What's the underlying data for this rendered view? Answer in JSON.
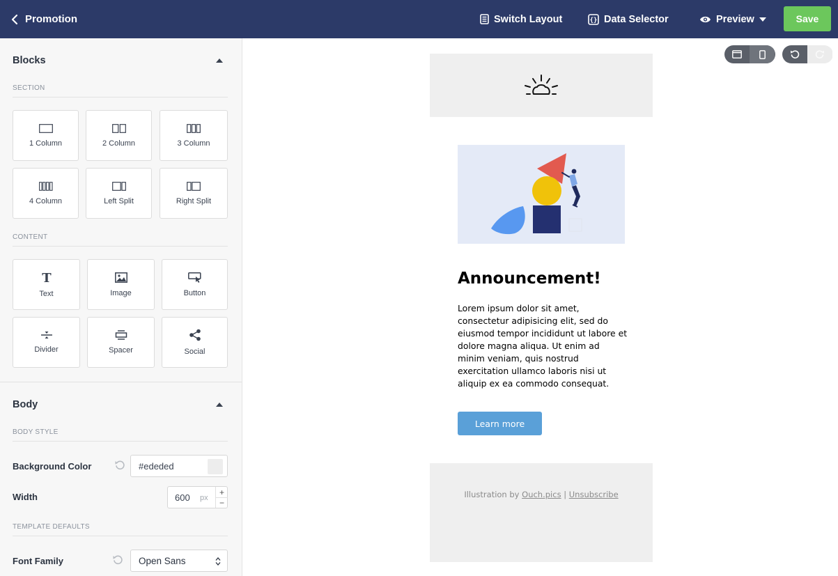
{
  "topbar": {
    "back_label": "Promotion",
    "switch_layout": "Switch Layout",
    "data_selector": "Data Selector",
    "preview": "Preview",
    "save": "Save"
  },
  "blocks_panel": {
    "title": "Blocks",
    "section_heading": "SECTION",
    "section_items": [
      {
        "label": "1 Column",
        "icon": "one-column-icon"
      },
      {
        "label": "2 Column",
        "icon": "two-column-icon"
      },
      {
        "label": "3 Column",
        "icon": "three-column-icon"
      },
      {
        "label": "4 Column",
        "icon": "four-column-icon"
      },
      {
        "label": "Left Split",
        "icon": "left-split-icon"
      },
      {
        "label": "Right Split",
        "icon": "right-split-icon"
      }
    ],
    "content_heading": "CONTENT",
    "content_items": [
      {
        "label": "Text",
        "icon": "text-icon"
      },
      {
        "label": "Image",
        "icon": "image-icon"
      },
      {
        "label": "Button",
        "icon": "button-icon"
      },
      {
        "label": "Divider",
        "icon": "divider-icon"
      },
      {
        "label": "Spacer",
        "icon": "spacer-icon"
      },
      {
        "label": "Social",
        "icon": "share-icon"
      }
    ]
  },
  "body_panel": {
    "title": "Body",
    "body_style_heading": "BODY STYLE",
    "background_color_label": "Background Color",
    "background_color_value": "#ededed",
    "width_label": "Width",
    "width_value": "600",
    "width_unit": "px",
    "template_defaults_heading": "TEMPLATE DEFAULTS",
    "font_family_label": "Font Family",
    "font_family_value": "Open Sans"
  },
  "email": {
    "headline": "Announcement!",
    "body": "Lorem ipsum dolor sit amet, consectetur adipisicing elit, sed do eiusmod tempor incididunt ut labore et dolore magna aliqua. Ut enim ad minim veniam, quis nostrud exercitation ullamco laboris nisi ut aliquip ex ea commodo consequat.",
    "cta": "Learn more",
    "footer_prefix": "Illustration by",
    "footer_link": "Ouch.pics",
    "footer_separator": "|",
    "footer_unsubscribe": "Unsubscribe"
  },
  "colors": {
    "topbar": "#2c3a68",
    "save": "#6cc75c",
    "cta": "#5aa0d8",
    "email_background": "#ededed"
  }
}
